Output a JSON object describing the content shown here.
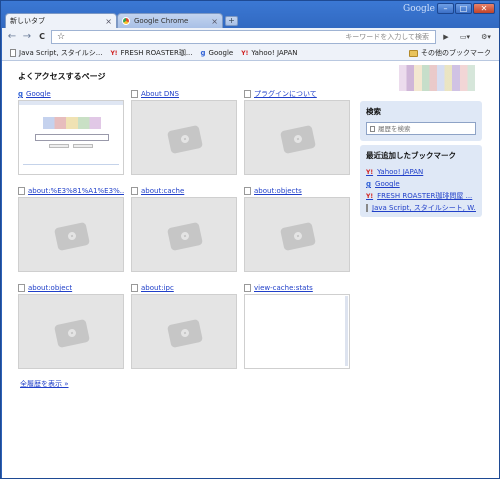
{
  "window": {
    "brand": "Google",
    "minimize": "–",
    "maximize": "□",
    "close": "✕"
  },
  "tabs": [
    {
      "label": "新しいタブ",
      "close": "×"
    },
    {
      "label": "Google Chrome",
      "close": "×"
    }
  ],
  "new_tab": "+",
  "toolbar": {
    "back": "←",
    "forward": "→",
    "reload": "C",
    "star": "☆",
    "omnibox_value": "",
    "omnibox_hint": "キーワードを入力して検索",
    "go": "▶",
    "page_menu": "▭▾",
    "tools_menu": "⚙▾"
  },
  "bookmarks_bar": {
    "items": [
      {
        "label": "Java Script, スタイルシ...",
        "icon": "doc-icon"
      },
      {
        "label": "FRESH ROASTER珈...",
        "icon": "yahoo-icon",
        "mark": "Y!"
      },
      {
        "label": "Google",
        "icon": "google-icon",
        "mark": "g"
      },
      {
        "label": "Yahoo! JAPAN",
        "icon": "yahoo-icon",
        "mark": "Y!"
      }
    ],
    "other": "その他のブックマーク"
  },
  "main": {
    "heading": "よくアクセスするページ",
    "thumbnails": [
      {
        "title": "Google",
        "icon": "g"
      },
      {
        "title": "About DNS"
      },
      {
        "title": "プラグインについて"
      },
      {
        "title": "about:%E3%81%A1%E3%..."
      },
      {
        "title": "about:cache"
      },
      {
        "title": "about:objects"
      },
      {
        "title": "about:object"
      },
      {
        "title": "about:ipc"
      },
      {
        "title": "view-cache:stats"
      }
    ],
    "show_all": "全履歴を表示 »"
  },
  "sidebar": {
    "search_title": "検索",
    "search_placeholder": "履歴を検索",
    "recent_title": "最近追加したブックマーク",
    "recent": [
      {
        "label": "Yahoo! JAPAN",
        "mark": "Y!"
      },
      {
        "label": "Google",
        "mark": "g"
      },
      {
        "label": "FRESH ROASTER珈琲問屋 ...",
        "mark": "Y!"
      },
      {
        "label": "Java Script, スタイルシート, W..."
      }
    ]
  },
  "colors": {
    "frame": "#2d62b8",
    "link": "#2140c9",
    "panel": "#dfe8f6",
    "placeholder_thumb": "#e4e4e4"
  }
}
